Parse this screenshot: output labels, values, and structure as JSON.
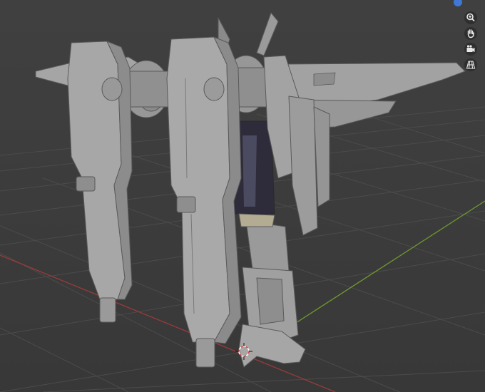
{
  "app": {
    "colors": {
      "background": "#3d3d3d",
      "grid": "#4a4a4a",
      "x_axis": "#9a3a3a",
      "y_axis": "#6f9a2e",
      "model_light": "#a4a4a4",
      "model_mid": "#8e8e8e",
      "model_dark": "#6a6a6a",
      "model_shadow": "#2c2a3a",
      "accent_blue": "#3f78d6",
      "button_bg": "#2f2f2f",
      "icon_fg": "#e8e8e8"
    }
  },
  "navigation": {
    "axis_indicator_color": "#3f78d6",
    "buttons": [
      {
        "name": "zoom",
        "icon": "magnifier-plus-icon"
      },
      {
        "name": "pan",
        "icon": "hand-icon"
      },
      {
        "name": "camera",
        "icon": "camera-icon"
      },
      {
        "name": "perspective",
        "icon": "grid-perspective-icon"
      }
    ]
  }
}
